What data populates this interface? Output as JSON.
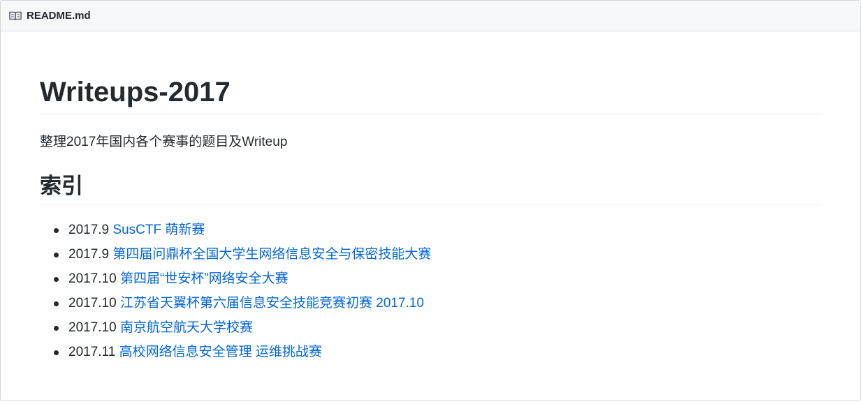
{
  "header": {
    "filename": "README.md",
    "icon": "book-icon"
  },
  "main": {
    "title": "Writeups-2017",
    "intro": "整理2017年国内各个赛事的题目及Writeup",
    "section_heading": "索引",
    "items": [
      {
        "date": "2017.9",
        "link": "SusCTF 萌新赛"
      },
      {
        "date": "2017.9",
        "link": "第四届问鼎杯全国大学生网络信息安全与保密技能大赛"
      },
      {
        "date": "2017.10",
        "link": "第四届“世安杯”网络安全大赛"
      },
      {
        "date": "2017.10",
        "link": "江苏省天翼杯第六届信息安全技能竞赛初赛 2017.10"
      },
      {
        "date": "2017.10",
        "link": "南京航空航天大学校赛"
      },
      {
        "date": "2017.11",
        "link": "高校网络信息安全管理 运维挑战赛"
      }
    ]
  },
  "colors": {
    "link": "#0366d6",
    "text": "#24292e",
    "header_bg": "#f6f8fa"
  }
}
